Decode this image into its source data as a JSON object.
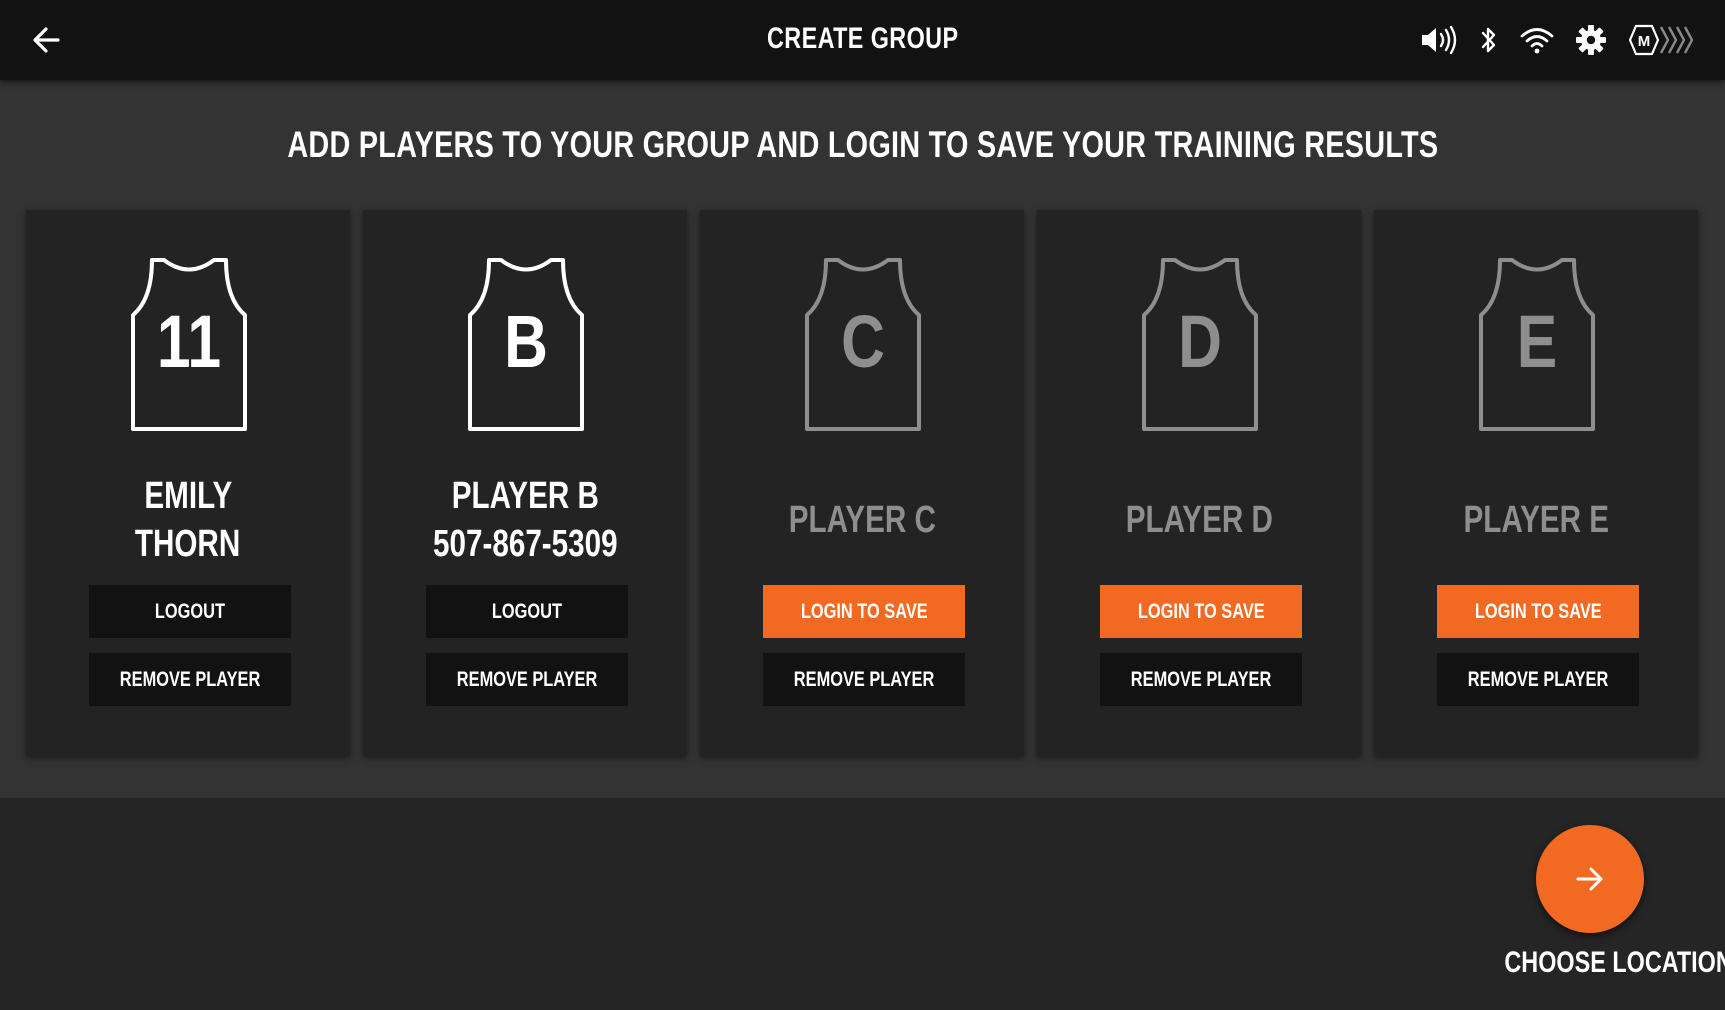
{
  "header": {
    "title": "CREATE GROUP",
    "status_icons": [
      "back-arrow-icon",
      "volume-icon",
      "bluetooth-icon",
      "wifi-icon",
      "gear-icon",
      "m-logo-icon"
    ],
    "m_logo_letter": "M"
  },
  "main": {
    "subtitle": "ADD PLAYERS TO YOUR GROUP AND LOGIN TO SAVE YOUR TRAINING RESULTS",
    "players": [
      {
        "jersey": "11",
        "name_line1": "EMILY",
        "name_line2": "THORN",
        "logged_in": true,
        "action_label": "LOGOUT",
        "remove_label": "REMOVE PLAYER"
      },
      {
        "jersey": "B",
        "name_line1": "PLAYER B",
        "name_line2": "507-867-5309",
        "logged_in": true,
        "action_label": "LOGOUT",
        "remove_label": "REMOVE PLAYER"
      },
      {
        "jersey": "C",
        "name_line1": "PLAYER C",
        "name_line2": "",
        "logged_in": false,
        "action_label": "LOGIN TO SAVE",
        "remove_label": "REMOVE PLAYER"
      },
      {
        "jersey": "D",
        "name_line1": "PLAYER D",
        "name_line2": "",
        "logged_in": false,
        "action_label": "LOGIN TO SAVE",
        "remove_label": "REMOVE PLAYER"
      },
      {
        "jersey": "E",
        "name_line1": "PLAYER E",
        "name_line2": "",
        "logged_in": false,
        "action_label": "LOGIN TO SAVE",
        "remove_label": "REMOVE PLAYER"
      }
    ]
  },
  "footer": {
    "next_label": "CHOOSE LOCATIONS"
  },
  "colors": {
    "accent": "#f26a22",
    "topbar": "#121212",
    "panel": "#333333",
    "card": "#232323",
    "active_text": "#ffffff",
    "inactive_text": "#8e8e8e"
  }
}
